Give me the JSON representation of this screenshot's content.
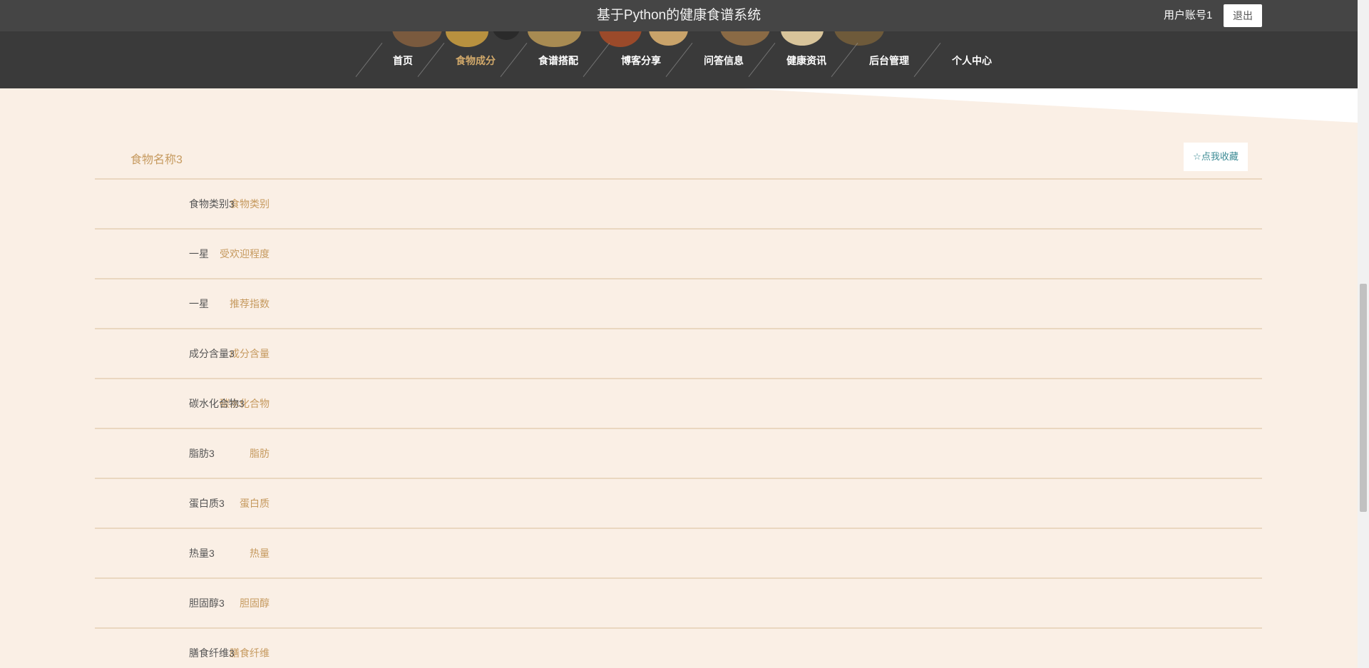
{
  "header": {
    "site_title": "基于Python的健康食谱系统",
    "user_name": "用户账号1",
    "logout_label": "退出"
  },
  "nav": {
    "items": [
      {
        "label": "首页"
      },
      {
        "label": "食物成分"
      },
      {
        "label": "食谱搭配"
      },
      {
        "label": "博客分享"
      },
      {
        "label": "问答信息"
      },
      {
        "label": "健康资讯"
      },
      {
        "label": "后台管理"
      },
      {
        "label": "个人中心"
      }
    ],
    "active_index": 1
  },
  "detail": {
    "title": "食物名称3",
    "favorite_label": "点我收藏",
    "favorite_icon": "star-outline-icon",
    "fields": [
      {
        "label": "食物类别",
        "value": "食物类别3"
      },
      {
        "label": "受欢迎程度",
        "value": "一星"
      },
      {
        "label": "推荐指数",
        "value": "一星"
      },
      {
        "label": "成分含量",
        "value": "成分含量3"
      },
      {
        "label": "碳水化合物",
        "value": "碳水化合物3"
      },
      {
        "label": "脂肪",
        "value": "脂肪3"
      },
      {
        "label": "蛋白质",
        "value": "蛋白质3"
      },
      {
        "label": "热量",
        "value": "热量3"
      },
      {
        "label": "胆固醇",
        "value": "胆固醇3"
      },
      {
        "label": "膳食纤维",
        "value": "膳食纤维3"
      }
    ]
  },
  "colors": {
    "accent": "#c69a5f",
    "nav_active": "#d2a96a",
    "page_background": "#faefe5",
    "header_background": "#454545",
    "favorite_text": "#3b8a94"
  }
}
